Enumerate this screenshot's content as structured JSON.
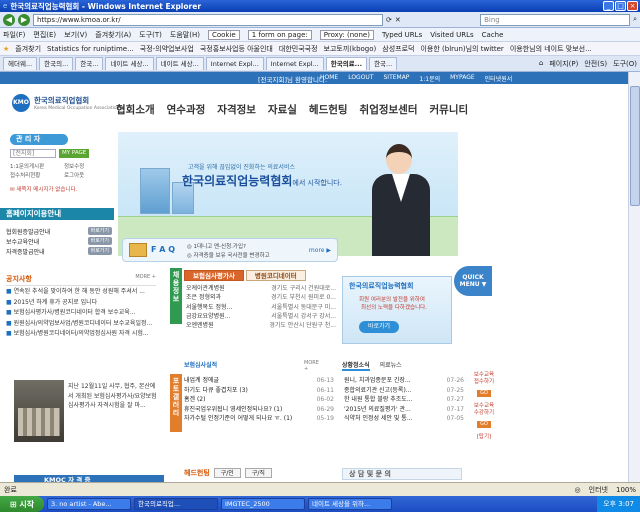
{
  "window": {
    "title": "한국의료직업능력협회 - Windows Internet Explorer",
    "minimize": "_",
    "maximize": "□",
    "close": "×"
  },
  "address": {
    "url": "https://www.kmoa.or.kr/",
    "search_placeholder": "Bing"
  },
  "menubar": {
    "items": [
      "파일(F)",
      "편집(E)",
      "보기(V)",
      "즐겨찾기(A)",
      "도구(T)",
      "도움말(H)"
    ],
    "field_cookie": "Cookie",
    "field_form": "1 form on page:",
    "field_proxy": "Proxy: (none)",
    "typed_urls": "Typed URLs",
    "visited_urls": "Visited URLs",
    "cache": "Cache"
  },
  "favbar": {
    "items": [
      "즐겨찾기",
      "Statistics for runiptime...",
      "국정-의약업보사업",
      "국정홍보사업등 아울인대",
      "대한민국국정",
      "보고토끼(kbogo)",
      "삼성프로덕",
      "이용한 (blrun)님의 twitter",
      "이용한님의 네이트 맞보선..."
    ]
  },
  "tabs": {
    "items": [
      "헤더웨...",
      "한국의...",
      "한국...",
      "네이트 세상...",
      "네이트 세상...",
      "Internet Expl...",
      "Internet Expl...",
      "한국의료...",
      "한국..."
    ],
    "active_index": 7,
    "tools": [
      "페이지(P)",
      "안전(S)",
      "도구(O)"
    ]
  },
  "site": {
    "welcome": "[전국지회]님 환영합니다.",
    "topnav": [
      "HOME",
      "LOGOUT",
      "SITEMAP",
      "1:1문의",
      "MYPAGE",
      "인터넷원서"
    ],
    "logo_mark": "KMO",
    "logo_name": "한국의료직업협회",
    "logo_en": "Korea Medical Occupation Association",
    "mainnav": [
      "협회소개",
      "연수과정",
      "자격정보",
      "자료실",
      "헤드헌팅",
      "취업정보센터",
      "커뮤니티"
    ],
    "login": {
      "title": "관 리 자",
      "field": "[전지회]",
      "mypage": "MY PAGE",
      "links": [
        "1:1문의게시판",
        "정보수정",
        "접수처리현황",
        "로그아웃"
      ],
      "note": "새쪽지 메시지가 없습니다."
    },
    "homepage": {
      "title": "홈페이지이용안내",
      "rows": [
        {
          "label": "협회원증발급안내",
          "btn": "바로가기"
        },
        {
          "label": "보수교육안내",
          "btn": "바로가기"
        },
        {
          "label": "자격증발급안내",
          "btn": "바로가기"
        }
      ]
    },
    "notice": {
      "title": "공지사항",
      "more": "MORE +",
      "items": [
        "연속된 추석을 맞이하여 한 해 동안 성원해 주셔서 ...",
        "2015년 하계 휴가 공지로 입니다",
        "보험심사평가사/병원코디네이터 합격 보수교육...",
        "원원심사/의약업보사업/병원코디네이터 보수교육일정...",
        "보험심사/병원코디네이터/의약업정심사원 자격 시험..."
      ]
    },
    "hero": {
      "sub": "고객을 위해 끊임없이 진화하는 의료서비스",
      "title": "한국의료직업능력협회",
      "title_tail": "에서 시작합니다."
    },
    "faq": {
      "label": "F A Q",
      "line1": "◎ 1대니고 맨-신청.가입?",
      "line2": "◎ 자격증을 보유 국사전을 변경하고",
      "arrow": "more ▶"
    },
    "cert": {
      "vtab": "채용정보",
      "tabs": [
        "보험심사평가사",
        "병원코디네이터"
      ],
      "rows": [
        {
          "l": "오케이관계병원",
          "r": "경기도 구리시 건원대로..."
        },
        {
          "l": "조은 정형외과",
          "r": "경기도 부천시 원미로 0..."
        },
        {
          "l": "서울행복도 정형...",
          "r": "서울특별시 동대문구 미..."
        },
        {
          "l": "금강요요양병원...",
          "r": "서울특별시 강서구 강서..."
        },
        {
          "l": "오엔엔병원",
          "r": "경기도 안산시 단원구 천..."
        }
      ]
    },
    "banner": {
      "title": "한국의료직업능력협회",
      "s1": "회원 여러분의 발전을 위하여",
      "s2": "최선의 노력을 다하겠습니다.",
      "btn": "바로가기"
    },
    "quick": {
      "line1": "QUICK",
      "line2": "MENU ▼"
    },
    "photo_text": "지난 12월11일 사무, 협주, 본산에서 개최된 보험심사평가사/요양보험심사평가사 자격시험을 잘 마...",
    "photo_vtab": "포토갤러리",
    "kmoc": "KMOC  자 격 증",
    "news": {
      "title": "보험심사실적",
      "more": "MORE +",
      "items": [
        {
          "t": "내업계 정에글",
          "d": "06-13"
        },
        {
          "t": "하기도 다큐 좋겹치포 (3)",
          "d": "06-11"
        },
        {
          "t": "홈겐 (2)",
          "d": "06-02"
        },
        {
          "t": "휴진국업우위됩니 영세인정되나요? (1)",
          "d": "06-29"
        },
        {
          "t": "자가수털 인정기준이 어떻게 되나요 ㅠ. (1)",
          "d": "05-19"
        }
      ]
    },
    "right_news": {
      "tabs": [
        "상황정소식",
        "의료뉴스"
      ],
      "items": [
        {
          "t": "원니, 치과업종문포 긴장...",
          "d": "07-26"
        },
        {
          "t": "종합의료기관 신고(등록)...",
          "d": "07-25"
        },
        {
          "t": "한 내원 통합 블랑 추조도...",
          "d": "07-27"
        },
        {
          "t": "'2015년 의료질평가' 관...",
          "d": "07-17"
        },
        {
          "t": "식약처 인정성 세안 및 통...",
          "d": "07-05"
        }
      ]
    },
    "side_right": {
      "a1": "보수교육",
      "a2": "접수하기",
      "b": "GO",
      "c1": "보수교육",
      "c2": "수강하기",
      "top": "[탑기]"
    },
    "bottom_center": {
      "label": "헤드헌팅",
      "tabs": [
        "구/인",
        "구/직"
      ]
    },
    "bottom_right": "상 담 및 문 의"
  },
  "status": {
    "left": "완료",
    "zone": "인터넷",
    "zoom": "100%"
  },
  "taskbar": {
    "start": "시작",
    "tasks": [
      "3. no artist - Abe...",
      "한국의료직업...",
      "IMGTEC_2500",
      "네이트 세상을 위하..."
    ],
    "active_index": 1,
    "time": "오후 3:07"
  }
}
